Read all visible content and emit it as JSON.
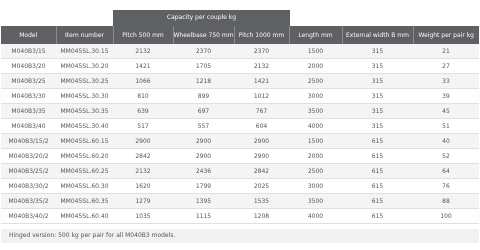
{
  "table": {
    "group_header": "Capacity per couple kg",
    "headers": [
      "Model",
      "Item number",
      "Pitch 500 mm",
      "Wheelbase 750 mm",
      "Pitch 1000 mm",
      "Length mm",
      "External width B mm",
      "Weight per pair kg"
    ],
    "rows": [
      [
        "M040B3/15",
        "MM045SL.30.15",
        "2132",
        "2370",
        "2370",
        "1500",
        "315",
        "21"
      ],
      [
        "M040B3/20",
        "MM045SL.30.20",
        "1421",
        "1705",
        "2132",
        "2000",
        "315",
        "27"
      ],
      [
        "M040B3/25",
        "MM045SL.30.25",
        "1066",
        "1218",
        "1421",
        "2500",
        "315",
        "33"
      ],
      [
        "M040B3/30",
        "MM045SL.30.30",
        "810",
        "899",
        "1012",
        "3000",
        "315",
        "39"
      ],
      [
        "M040B3/35",
        "MM045SL.30.35",
        "639",
        "697",
        "767",
        "3500",
        "315",
        "45"
      ],
      [
        "M040B3/40",
        "MM045SL.30.40",
        "517",
        "557",
        "604",
        "4000",
        "315",
        "51"
      ],
      [
        "M040B3/15/2",
        "MM045SL.60.15",
        "2900",
        "2900",
        "2900",
        "1500",
        "615",
        "40"
      ],
      [
        "M040B3/20/2",
        "MM045SL.60.20",
        "2842",
        "2900",
        "2900",
        "2000",
        "615",
        "52"
      ],
      [
        "M040B3/25/2",
        "MM045SL.60.25",
        "2132",
        "2436",
        "2842",
        "2500",
        "615",
        "64"
      ],
      [
        "M040B3/30/2",
        "MM045SL.60.30",
        "1620",
        "1799",
        "2025",
        "3000",
        "615",
        "76"
      ],
      [
        "M040B3/35/2",
        "MM045SL.60.35",
        "1279",
        "1395",
        "1535",
        "3500",
        "615",
        "88"
      ],
      [
        "M040B3/40/2",
        "MM045SL.60.40",
        "1035",
        "1115",
        "1208",
        "4000",
        "615",
        "100"
      ]
    ]
  },
  "footer_note": "Hinged version: 500 kg per pair for all M040B3 models."
}
